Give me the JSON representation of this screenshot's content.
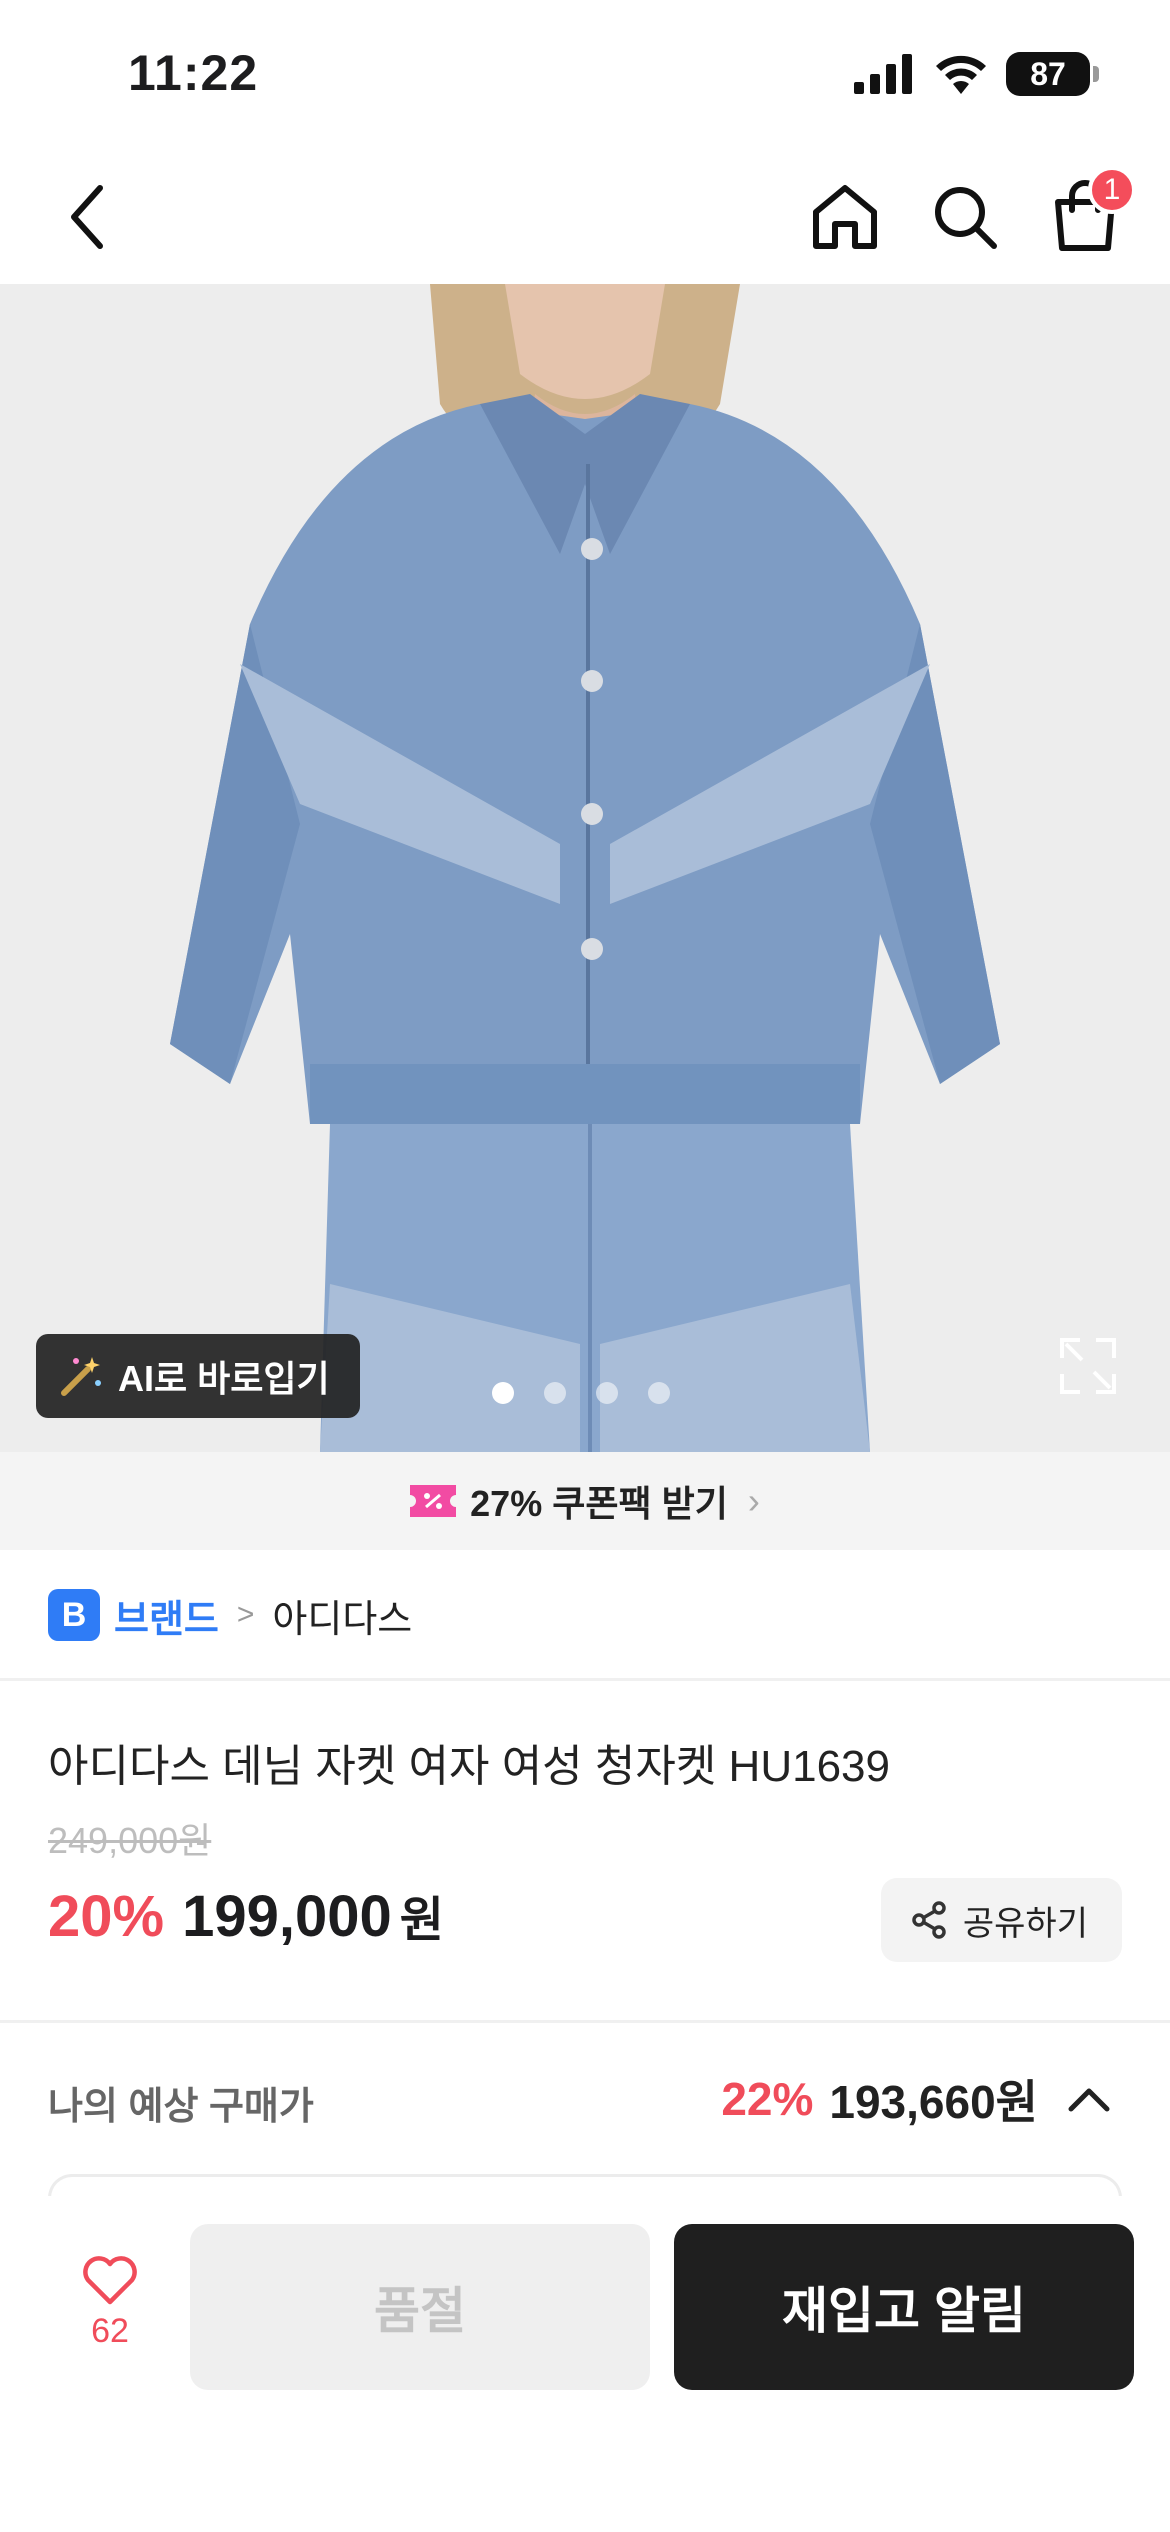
{
  "status_bar": {
    "time": "11:22",
    "battery": "87",
    "icons": [
      "cellular-signal-icon",
      "wifi-icon",
      "battery-icon"
    ]
  },
  "nav": {
    "icons": [
      "back-chevron-icon",
      "home-icon",
      "search-icon",
      "shopping-bag-icon"
    ],
    "cart_badge": "1"
  },
  "hero": {
    "ai_button_label": "AI로 바로입기",
    "ai_icon": "magic-wand-icon",
    "pages": 4,
    "current_page": 1,
    "expand_icon": "expand-icon"
  },
  "coupon": {
    "icon": "coupon-ticket-icon",
    "label": "27% 쿠폰팩 받기",
    "chevron": "›"
  },
  "brand": {
    "badge": "B",
    "label": "브랜드",
    "separator": ">",
    "name": "아디다스"
  },
  "product": {
    "title": "아디다스 데님 자켓 여자 여성 청자켓 HU1639",
    "original_price": "249,000원",
    "discount": "20%",
    "price": "199,000",
    "currency": "원",
    "share_label": "공유하기"
  },
  "expected": {
    "label": "나의 예상 구매가",
    "discount": "22%",
    "price": "193,660원"
  },
  "bottom": {
    "wish_count": "62",
    "soldout_label": "품절",
    "restock_label": "재입고 알림"
  },
  "colors": {
    "accent_red": "#f04c5a",
    "brand_blue": "#2f7cf6",
    "dark_button": "#1f1f1f"
  }
}
